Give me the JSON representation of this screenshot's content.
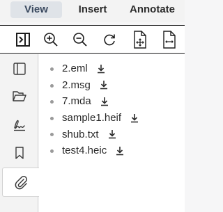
{
  "menubar": {
    "tabs": [
      {
        "label": "View",
        "active": true
      },
      {
        "label": "Insert",
        "active": false
      },
      {
        "label": "Annotate",
        "active": false
      }
    ]
  },
  "toolbar": {
    "buttons": [
      {
        "icon": "toggle-sidebar-icon"
      },
      {
        "icon": "zoom-in-icon"
      },
      {
        "icon": "zoom-out-icon"
      },
      {
        "icon": "rotate-icon"
      },
      {
        "icon": "fit-page-icon"
      },
      {
        "icon": "fit-width-icon"
      }
    ]
  },
  "sidebar": {
    "buttons": [
      {
        "icon": "panel-icon",
        "active": false
      },
      {
        "icon": "folder-open-icon",
        "active": false
      },
      {
        "icon": "signature-icon",
        "active": false
      },
      {
        "icon": "bookmark-icon",
        "active": false
      },
      {
        "icon": "paperclip-icon",
        "active": true
      }
    ]
  },
  "attachments": {
    "files": [
      {
        "name": "2.eml"
      },
      {
        "name": "2.msg"
      },
      {
        "name": "7.mda"
      },
      {
        "name": "sample1.heif"
      },
      {
        "name": "shub.txt"
      },
      {
        "name": "test4.heic"
      }
    ]
  },
  "colors": {
    "active_tab_bg": "#dfe3e8",
    "active_tab_text": "#3b4a60",
    "border": "#1c1c1c"
  }
}
